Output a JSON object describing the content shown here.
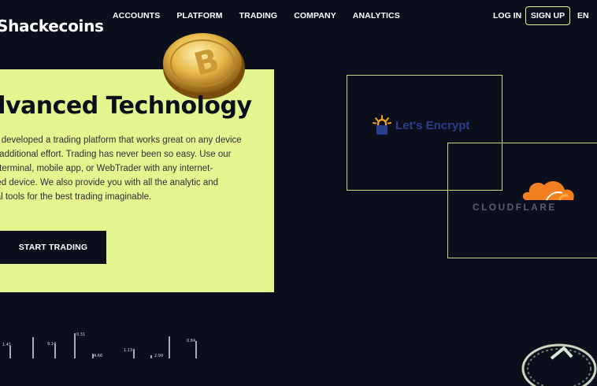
{
  "header": {
    "logo": "Shackecoins",
    "nav": [
      "ACCOUNTS",
      "PLATFORM",
      "TRADING",
      "COMPANY",
      "ANALYTICS"
    ],
    "login": "LOG IN",
    "signup": "SIGN UP",
    "lang": "EN"
  },
  "hero": {
    "title": "dvanced Technology",
    "description_lines": [
      "ave developed a trading platform that works great on any device",
      "out additional effort. Trading has never been so easy. Use our",
      "top terminal, mobile app, or WebTrader with any internet-",
      "ected device. We also provide you with all the analytic and",
      "nical tools for the best trading imaginable."
    ],
    "cta": "START TRADING"
  },
  "partners": {
    "letsencrypt": "Let's Encrypt",
    "cloudflare": "CLOUDFLARE"
  },
  "ticker": {
    "values": [
      "1.41",
      "9.14",
      "0.31",
      "4.66",
      "1.13",
      "2.99",
      "0.84"
    ]
  },
  "colors": {
    "background": "#0b0f1c",
    "accent": "#e4f58f",
    "letsencrypt_blue": "#2b3e8c",
    "letsencrypt_orange": "#f7a51c",
    "cloudflare_orange": "#f38020"
  }
}
